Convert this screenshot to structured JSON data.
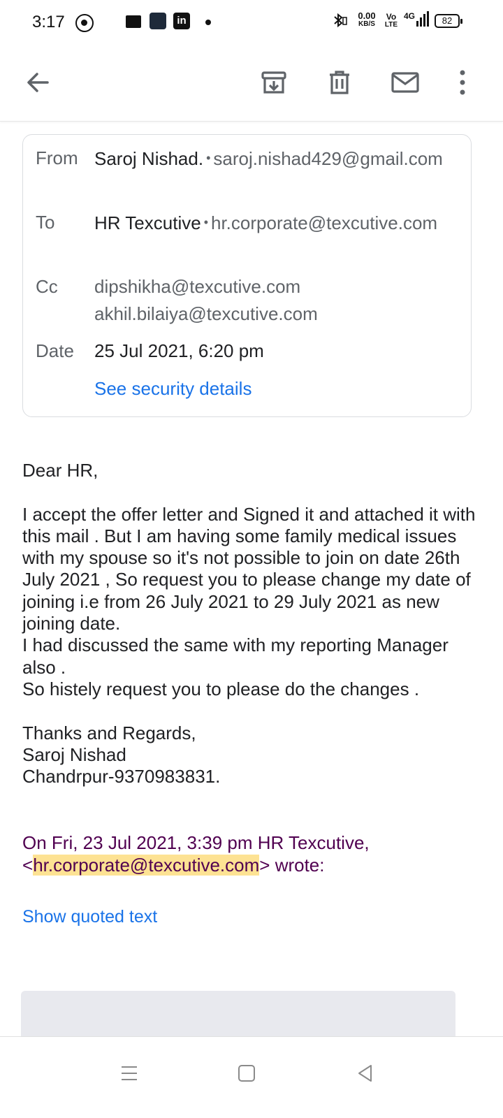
{
  "status_bar": {
    "time": "3:17",
    "net_speed_value": "0.00",
    "net_speed_unit": "KB/S",
    "volte_top": "Vo",
    "volte_bottom": "LTE",
    "network": "4G",
    "battery": "82",
    "linkedin": "in"
  },
  "toolbar": {
    "icons": [
      "back-arrow-icon",
      "archive-icon",
      "delete-icon",
      "mark-unread-icon",
      "more-vert-icon"
    ]
  },
  "header": {
    "from_label": "From",
    "from_name": "Saroj Nishad.",
    "from_email": "saroj.nishad429@gmail.com",
    "to_label": "To",
    "to_name": "HR Texcutive",
    "to_email": "hr.corporate@texcutive.com",
    "cc_label": "Cc",
    "cc": [
      "dipshikha@texcutive.com",
      "akhil.bilaiya@texcutive.com"
    ],
    "date_label": "Date",
    "date": "25 Jul 2021, 6:20 pm",
    "security_link": "See security details"
  },
  "body": {
    "greeting": "Dear HR,",
    "paragraph1": "I accept the offer letter and Signed it and attached it with this mail . But I am having some family medical issues with my spouse so it's not possible to join on date 26th July 2021 , So request you to please change my date of joining i.e from 26 July 2021 to 29 July 2021 as new joining date.",
    "paragraph2": "I had discussed the same with my reporting Manager also .",
    "paragraph3": "So histely request you to please do the changes .",
    "signoff": "Thanks and Regards,",
    "sig_name": "Saroj Nishad",
    "sig_contact": "Chandrpur-9370983831."
  },
  "quote": {
    "attribution_prefix": "On Fri, 23 Jul 2021, 3:39 pm HR Texcutive, <",
    "attribution_email": "hr.corporate@texcutive.com",
    "attribution_suffix": "> wrote:",
    "show_quoted": "Show quoted text"
  },
  "colors": {
    "link": "#1a73e8",
    "quote": "#500050",
    "highlight": "#fde293"
  }
}
